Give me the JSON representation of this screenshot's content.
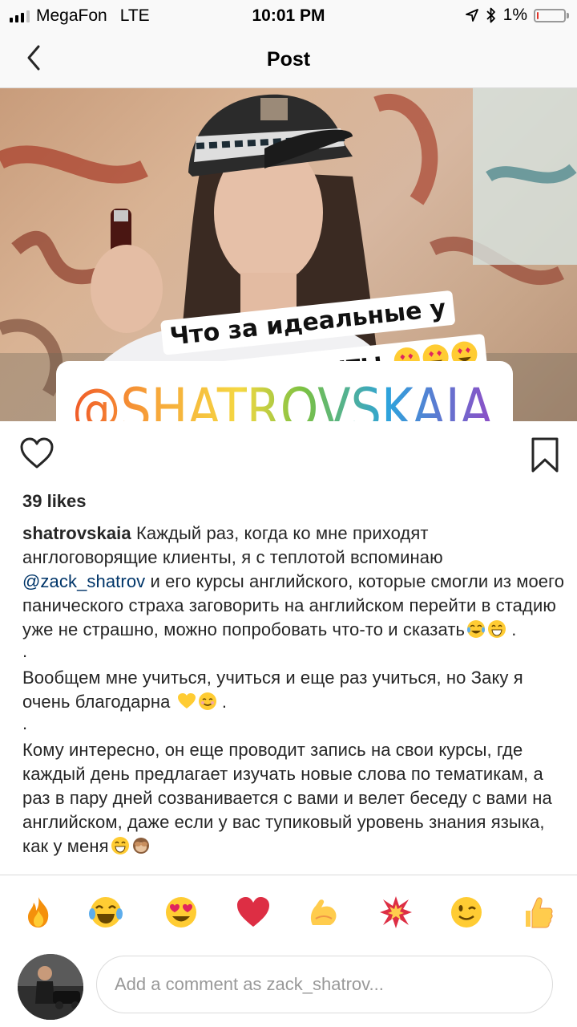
{
  "status_bar": {
    "carrier": "MegaFon",
    "network": "LTE",
    "time": "10:01 PM",
    "battery_percent": "1%",
    "battery_level": 0.01,
    "signal_bars": 3,
    "signal_total": 4,
    "icons": [
      "location-arrow-icon",
      "bluetooth-icon",
      "battery-icon"
    ]
  },
  "nav": {
    "title": "Post",
    "back_icon": "chevron-left-icon"
  },
  "post_image": {
    "sticker_line_1": "Что за идеальные у",
    "sticker_line_2": "меня студенты",
    "sticker_emojis": [
      "heart-eyes-emoji",
      "heart-eyes-emoji",
      "heart-eyes-emoji"
    ],
    "mention_sticker": "@SHATROVSKAIA"
  },
  "actions": {
    "like_icon": "heart-outline-icon",
    "save_icon": "bookmark-outline-icon"
  },
  "likes": "39 likes",
  "caption": {
    "username": "shatrovskaia",
    "p1_a": "Каждый раз, когда ко мне приходят англоговорящие клиенты, я с теплотой вспоминаю",
    "mention": "@zack_shatrov",
    "p1_b": "и его курсы английского, которые смогли из моего панического страха заговорить на английском перейти в стадию уже не страшно, можно попробовать что-то и сказать",
    "p1_end": ".",
    "dot": ".",
    "p2": "Вообщем мне учиться, учиться и еще раз учиться, но Заку я очень благодарна",
    "p2_end": ".",
    "p3": "Кому интересно, он еще проводит запись на свои курсы, где каждый день предлагает изучать новые слова по тематикам, а раз в пару дней созванивается с вами и велет беседу с вами на английском, даже если у вас тупиковый уровень знания языка, как у меня"
  },
  "reactions": [
    "fire-emoji",
    "tears-of-joy-emoji",
    "heart-eyes-emoji",
    "red-heart-emoji",
    "flexed-biceps-emoji",
    "collision-emoji",
    "winking-face-emoji",
    "thumbs-up-emoji"
  ],
  "comment": {
    "placeholder": "Add a comment as zack_shatrov..."
  },
  "colors": {
    "text": "#262626",
    "mention": "#003569",
    "divider": "#dbdbdb",
    "placeholder": "#999999",
    "battery_low": "#e0352b"
  }
}
